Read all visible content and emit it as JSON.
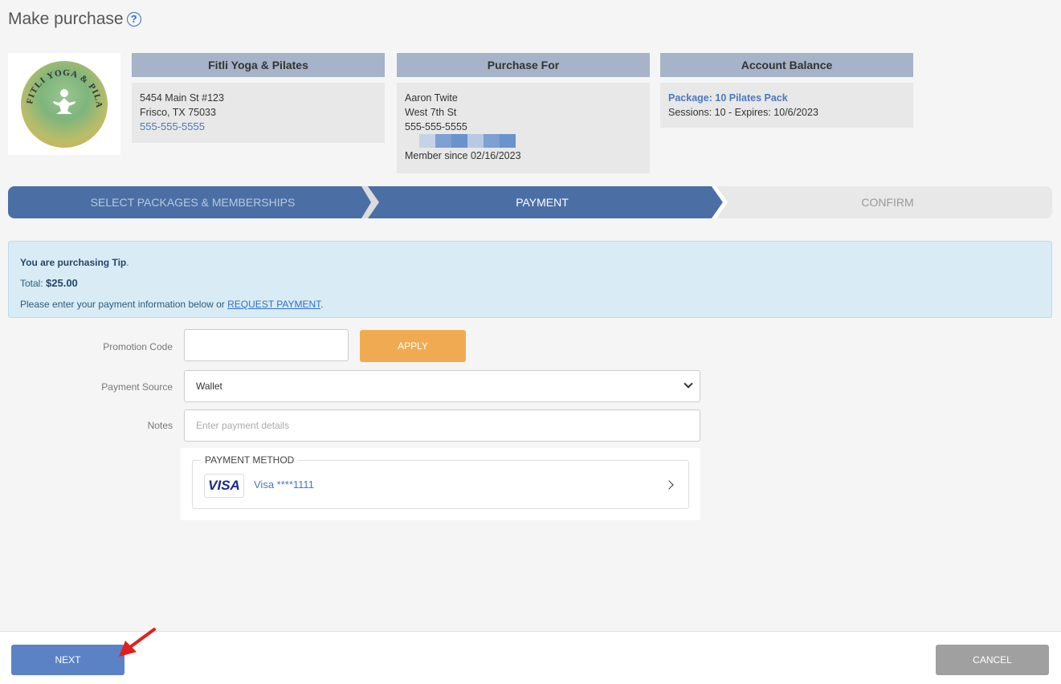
{
  "page": {
    "title": "Make purchase",
    "help_glyph": "?"
  },
  "studio": {
    "logo_text": "FITLI YOGA & PILATES",
    "header": "Fitli Yoga & Pilates",
    "address1": "5454 Main St #123",
    "address2": "Frisco, TX 75033",
    "phone": "555-555-5555"
  },
  "purchase_for": {
    "header": "Purchase For",
    "name": "Aaron Twite",
    "street": "West 7th St",
    "phone": "555-555-5555",
    "member_since": "Member since 02/16/2023"
  },
  "account_balance": {
    "header": "Account Balance",
    "package": "Package: 10 Pilates Pack",
    "sessions": "Sessions: 10 - Expires: 10/6/2023"
  },
  "steps": {
    "step1": "SELECT PACKAGES & MEMBERSHIPS",
    "step2": "PAYMENT",
    "step3": "CONFIRM"
  },
  "alert": {
    "purchasing_prefix": "You are purchasing Tip",
    "purchasing_suffix": ".",
    "total_label": "Total: ",
    "total_value": "$25.00",
    "instructions_prefix": "Please enter your payment information below or ",
    "request_link": "REQUEST PAYMENT",
    "instructions_suffix": "."
  },
  "form": {
    "promo_label": "Promotion Code",
    "promo_value": "",
    "apply_label": "APPLY",
    "source_label": "Payment Source",
    "source_value": "Wallet",
    "notes_label": "Notes",
    "notes_placeholder": "Enter payment details"
  },
  "payment_method": {
    "legend": "PAYMENT METHOD",
    "brand": "VISA",
    "card_text": "Visa ****1111"
  },
  "footer": {
    "next_label": "NEXT",
    "cancel_label": "CANCEL"
  },
  "colors": {
    "stepper_active": "#4b6fa5",
    "apply": "#f0ab52",
    "next": "#5b82c4",
    "cancel": "#a0a0a0",
    "card_header": "#a6b3c8",
    "alert_bg": "#d9ecf5",
    "annotation_arrow": "#e02020"
  }
}
